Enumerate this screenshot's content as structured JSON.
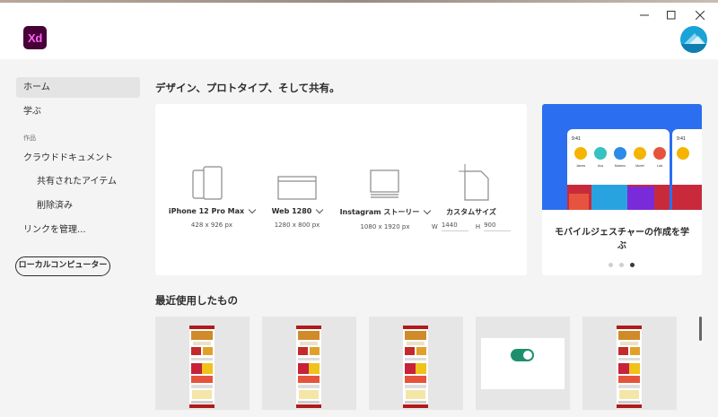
{
  "app": {
    "logo": "Xd"
  },
  "window_controls": {
    "minimize_icon": "minimize-icon",
    "maximize_icon": "maximize-icon",
    "close_icon": "close-icon"
  },
  "sidebar": {
    "home": "ホーム",
    "learn": "学ぶ",
    "section_works": "作品",
    "cloud_documents": "クラウドドキュメント",
    "shared": "共有されたアイテム",
    "deleted": "削除済み",
    "manage_links": "リンクを管理...",
    "local_computer": "ローカルコンピューター"
  },
  "main": {
    "heading": "デザイン、プロトタイプ、そして共有。",
    "presets": [
      {
        "name": "iPhone 12 Pro Max",
        "size": "428 x 926 px"
      },
      {
        "name": "Web 1280",
        "size": "1280 x 800 px"
      },
      {
        "name": "Instagram ストーリー",
        "size": "1080 x 1920 px"
      }
    ],
    "custom": {
      "name": "カスタムサイズ",
      "w_label": "W",
      "w_value": "1440",
      "h_label": "H",
      "h_value": "900"
    },
    "promo": {
      "text": "モバイルジェスチャーの作成を学ぶ",
      "time": "9:41",
      "people": [
        "James",
        "Ava",
        "Maximo",
        "Muriel",
        "Luis"
      ],
      "page_index": 3,
      "page_count": 3
    },
    "recent_heading": "最近使用したもの"
  },
  "colors": {
    "xd_bg": "#470137",
    "xd_fg": "#ff61f6",
    "promo_blue": "#2b6ef0",
    "toggle_green": "#1e8f6c"
  }
}
